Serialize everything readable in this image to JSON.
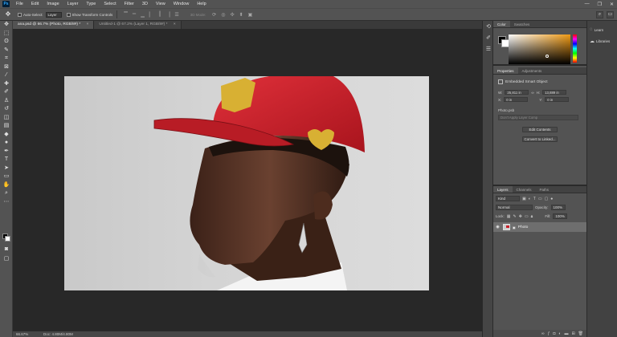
{
  "app": {
    "logo": "Ps"
  },
  "menu": [
    "File",
    "Edit",
    "Image",
    "Layer",
    "Type",
    "Select",
    "Filter",
    "3D",
    "View",
    "Window",
    "Help"
  ],
  "window_controls": [
    "—",
    "❐",
    "✕"
  ],
  "options_bar": {
    "auto_select_label": "Auto-Select:",
    "auto_select_value": "Layer",
    "transform_label": "Show Transform Controls",
    "mode_3d_label": "3D Mode:"
  },
  "tabs": [
    {
      "label": "ana.psd @ 66.7% (Photo, RGB/8#) *",
      "close": "×"
    },
    {
      "label": "Untitled-1 @ 67.2% (Layer 1, RGB/8#) *",
      "close": "×"
    }
  ],
  "status": {
    "zoom": "66.67%",
    "doc": "Doc: 4.80M/4.80M"
  },
  "color_panel": {
    "tabs": [
      "Color",
      "Swatches"
    ]
  },
  "properties": {
    "tabs": [
      "Properties",
      "Adjustments"
    ],
    "smart_object_label": "Embedded Smart Object",
    "w_label": "W:",
    "w_value": "25,811 in",
    "h_label": "H:",
    "h_value": "13,889 in",
    "x_label": "X:",
    "x_value": "0 in",
    "y_label": "Y:",
    "y_value": "0 in",
    "file_name": "Photo.psb",
    "layer_comp_placeholder": "Don't Apply Layer Comp",
    "edit_contents": "Edit Contents",
    "convert_linked": "Convert to Linked..."
  },
  "layers": {
    "tabs": [
      "Layers",
      "Channels",
      "Paths"
    ],
    "kind_label": "Kind",
    "blend_mode": "Normal",
    "opacity_label": "Opacity:",
    "opacity_value": "100%",
    "lock_label": "Lock:",
    "fill_label": "Fill:",
    "fill_value": "100%",
    "layer_name": "Photo"
  },
  "learn_panel": {
    "learn": "Learn",
    "libraries": "Libraries"
  },
  "colors": {
    "cap_red": "#c8202a",
    "cap_gold": "#d8b033",
    "skin": "#5a3626",
    "background": "#d2d2d2"
  }
}
